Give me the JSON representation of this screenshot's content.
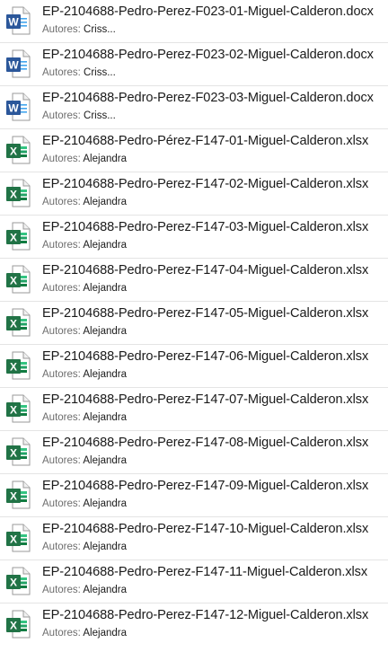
{
  "colors": {
    "word_brand": "#2b579a",
    "excel_brand": "#217346",
    "row_divider": "#e4e4e4",
    "label_gray": "#6d6d6d"
  },
  "files": [
    {
      "name": "EP-2104688-Pedro-Perez-F023-01-Miguel-Calderon.docx",
      "author_label": "Autores:",
      "author": "Criss...",
      "icon": "word-icon"
    },
    {
      "name": "EP-2104688-Pedro-Perez-F023-02-Miguel-Calderon.docx",
      "author_label": "Autores:",
      "author": "Criss...",
      "icon": "word-icon"
    },
    {
      "name": "EP-2104688-Pedro-Perez-F023-03-Miguel-Calderon.docx",
      "author_label": "Autores:",
      "author": "Criss...",
      "icon": "word-icon"
    },
    {
      "name": "EP-2104688-Pedro-Pérez-F147-01-Miguel-Calderon.xlsx",
      "author_label": "Autores:",
      "author": "Alejandra",
      "icon": "excel-icon"
    },
    {
      "name": "EP-2104688-Pedro-Perez-F147-02-Miguel-Calderon.xlsx",
      "author_label": "Autores:",
      "author": "Alejandra",
      "icon": "excel-icon"
    },
    {
      "name": "EP-2104688-Pedro-Perez-F147-03-Miguel-Calderon.xlsx",
      "author_label": "Autores:",
      "author": "Alejandra",
      "icon": "excel-icon"
    },
    {
      "name": "EP-2104688-Pedro-Perez-F147-04-Miguel-Calderon.xlsx",
      "author_label": "Autores:",
      "author": "Alejandra",
      "icon": "excel-icon"
    },
    {
      "name": "EP-2104688-Pedro-Perez-F147-05-Miguel-Calderon.xlsx",
      "author_label": "Autores:",
      "author": "Alejandra",
      "icon": "excel-icon"
    },
    {
      "name": "EP-2104688-Pedro-Perez-F147-06-Miguel-Calderon.xlsx",
      "author_label": "Autores:",
      "author": "Alejandra",
      "icon": "excel-icon"
    },
    {
      "name": "EP-2104688-Pedro-Perez-F147-07-Miguel-Calderon.xlsx",
      "author_label": "Autores:",
      "author": "Alejandra",
      "icon": "excel-icon"
    },
    {
      "name": "EP-2104688-Pedro-Perez-F147-08-Miguel-Calderon.xlsx",
      "author_label": "Autores:",
      "author": "Alejandra",
      "icon": "excel-icon"
    },
    {
      "name": "EP-2104688-Pedro-Perez-F147-09-Miguel-Calderon.xlsx",
      "author_label": "Autores:",
      "author": "Alejandra",
      "icon": "excel-icon"
    },
    {
      "name": "EP-2104688-Pedro-Perez-F147-10-Miguel-Calderon.xlsx",
      "author_label": "Autores:",
      "author": "Alejandra",
      "icon": "excel-icon"
    },
    {
      "name": "EP-2104688-Pedro-Perez-F147-11-Miguel-Calderon.xlsx",
      "author_label": "Autores:",
      "author": "Alejandra",
      "icon": "excel-icon"
    },
    {
      "name": "EP-2104688-Pedro-Perez-F147-12-Miguel-Calderon.xlsx",
      "author_label": "Autores:",
      "author": "Alejandra",
      "icon": "excel-icon"
    }
  ]
}
